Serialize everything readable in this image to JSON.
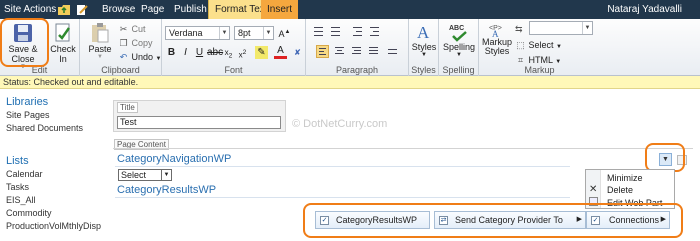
{
  "topbar": {
    "site_actions": "Site Actions",
    "tabs": {
      "browse": "Browse",
      "page": "Page",
      "publish": "Publish",
      "format_text": "Format Text",
      "insert": "Insert"
    },
    "user": "Nataraj Yadavalli"
  },
  "ribbon": {
    "edit": {
      "save_close": "Save & Close",
      "check_in": "Check In",
      "label": "Edit"
    },
    "clipboard": {
      "paste": "Paste",
      "cut": "Cut",
      "copy": "Copy",
      "undo": "Undo",
      "label": "Clipboard"
    },
    "font": {
      "family": "Verdana",
      "size": "8pt",
      "label": "Font"
    },
    "paragraph": {
      "label": "Paragraph"
    },
    "styles": {
      "styles": "Styles",
      "label": "Styles"
    },
    "spelling": {
      "spelling": "Spelling",
      "label": "Spelling"
    },
    "markup": {
      "markup_styles_line1": "Markup",
      "markup_styles_line2": "Styles",
      "select": "Select",
      "html": "HTML",
      "label": "Markup"
    }
  },
  "status": "Status: Checked out and editable.",
  "nav": {
    "libraries_heading": "Libraries",
    "libraries": [
      "Site Pages",
      "Shared Documents"
    ],
    "lists_heading": "Lists",
    "lists": [
      "Calendar",
      "Tasks",
      "EIS_All",
      "Commodity",
      "ProductionVolMthlyDisp"
    ]
  },
  "main": {
    "title_label": "Title",
    "title_value": "Test",
    "watermark": "© DotNetCurry.com",
    "page_content_label": "Page Content",
    "wp1_title": "CategoryNavigationWP",
    "select_value": "Select",
    "wp2_title": "CategoryResultsWP"
  },
  "menu": {
    "minimize": "Minimize",
    "delete": "Delete",
    "edit_web_part": "Edit Web Part",
    "connections": "Connections"
  },
  "connections": {
    "target": "CategoryResultsWP",
    "send": "Send Category Provider To"
  },
  "colors": {
    "topbar": "#21374c",
    "format_tab": "#fbe08c",
    "insert_tab": "#f5a73e",
    "highlight": "#f07d17",
    "link": "#1f6fb2"
  }
}
